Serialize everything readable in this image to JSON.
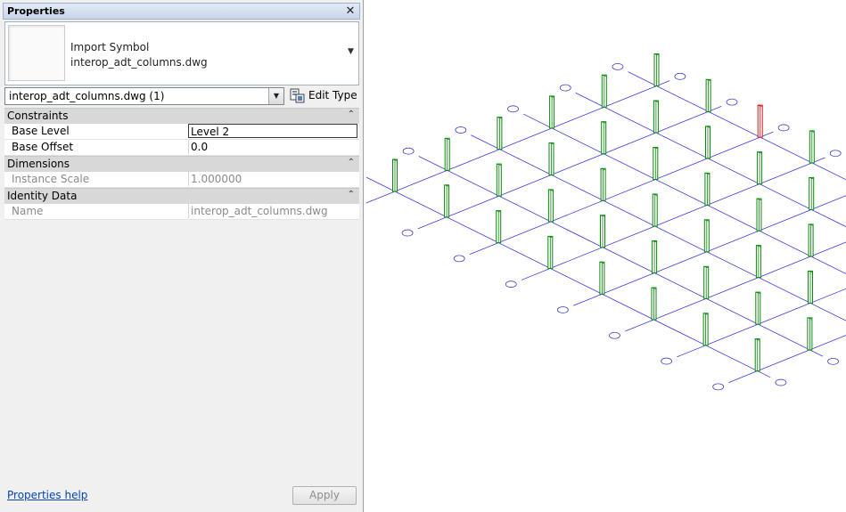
{
  "panel": {
    "title": "Properties",
    "close_icon": "close-icon",
    "type_selector": {
      "family": "Import Symbol",
      "type": "interop_adt_columns.dwg",
      "arrow_icon": "dropdown-arrow-icon"
    },
    "instance_filter": "interop_adt_columns.dwg (1)",
    "edit_type_label": "Edit Type",
    "groups": [
      {
        "name": "Constraints",
        "rows": [
          {
            "name": "Base Level",
            "value": "Level 2"
          },
          {
            "name": "Base Offset",
            "value": "0.0"
          }
        ]
      },
      {
        "name": "Dimensions",
        "rows": [
          {
            "name": "Instance Scale",
            "value": "1.000000"
          }
        ]
      },
      {
        "name": "Identity Data",
        "rows": [
          {
            "name": "Name",
            "value": "interop_adt_columns.dwg"
          }
        ]
      }
    ],
    "help_link": "Properties help",
    "apply_label": "Apply"
  },
  "view": {
    "grid_line_color": "#3c3cd8",
    "grid_bubble_color": "#4040c0",
    "column_color": "#0a8a0a",
    "selected_column_color": "#e01010",
    "column_count": 48
  }
}
